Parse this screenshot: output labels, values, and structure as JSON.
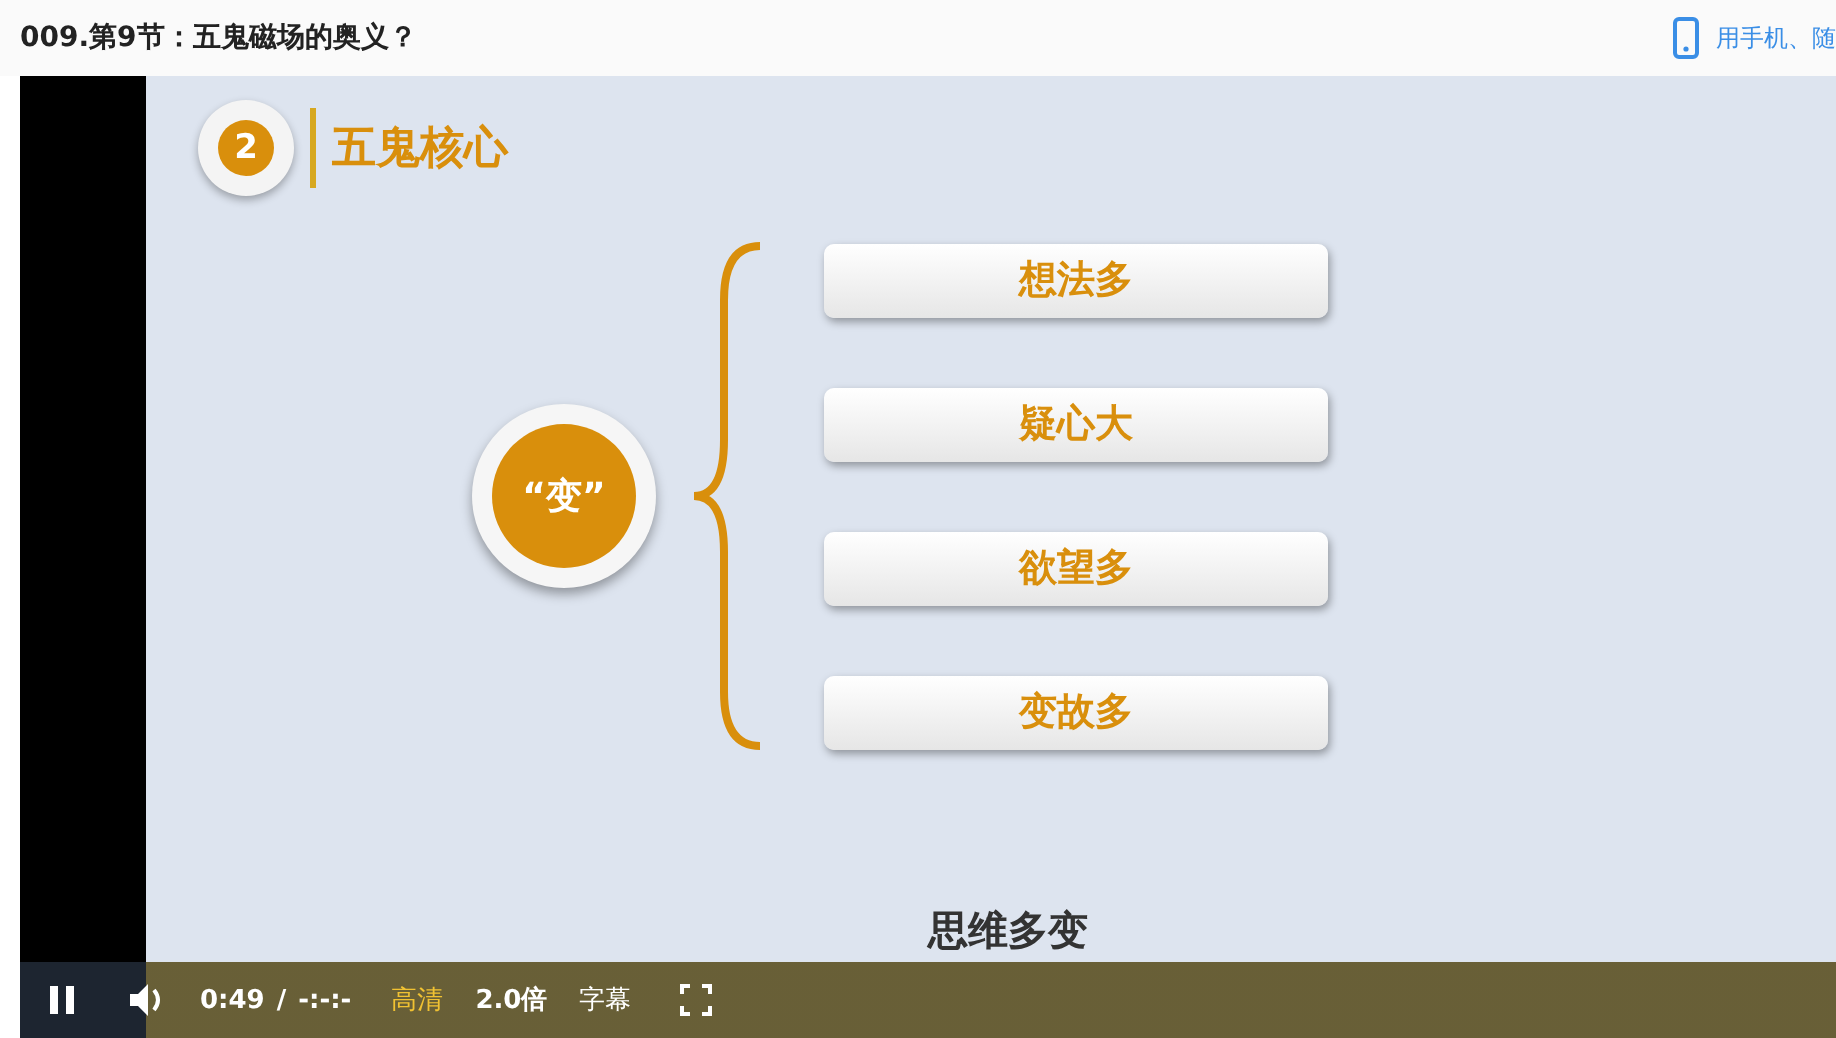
{
  "page": {
    "title": "009.第9节：五鬼磁场的奥义？",
    "mobile_link": "用手机、随"
  },
  "slide": {
    "section_number": "2",
    "section_title": "五鬼核心",
    "center_label": "“变”",
    "items": [
      "想法多",
      "疑心大",
      "欲望多",
      "变故多"
    ],
    "subtitle": "思维多变"
  },
  "player": {
    "playing": true,
    "current_time": "0:49",
    "separator": "/",
    "duration": "-:-:-",
    "quality": "高清",
    "speed": "2.0倍",
    "captions": "字幕"
  }
}
